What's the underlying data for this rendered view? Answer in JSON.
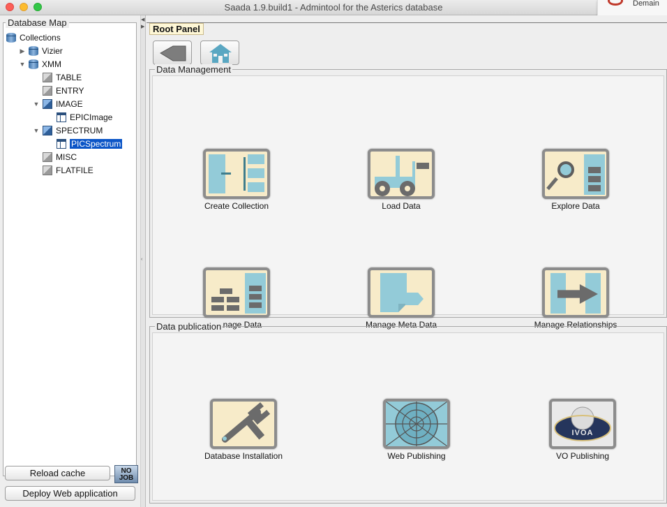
{
  "window": {
    "title": "Saada 1.9.build1 - Admintool for the Asterics database"
  },
  "notification": {
    "text": "Demain"
  },
  "tree": {
    "title": "Database Map",
    "nodes": [
      {
        "label": "Collections",
        "indent": 0,
        "toggle": "",
        "icon": "database-icon"
      },
      {
        "label": "Vizier",
        "indent": 1,
        "toggle": "▶",
        "icon": "database-icon"
      },
      {
        "label": "XMM",
        "indent": 1,
        "toggle": "▼",
        "icon": "database-icon"
      },
      {
        "label": "TABLE",
        "indent": 2,
        "toggle": "",
        "icon": "cube-icon"
      },
      {
        "label": "ENTRY",
        "indent": 2,
        "toggle": "",
        "icon": "cube-icon"
      },
      {
        "label": "IMAGE",
        "indent": 2,
        "toggle": "▼",
        "icon": "cube-blue-icon"
      },
      {
        "label": "EPICImage",
        "indent": 3,
        "toggle": "",
        "icon": "table-icon"
      },
      {
        "label": "SPECTRUM",
        "indent": 2,
        "toggle": "▼",
        "icon": "cube-blue-icon"
      },
      {
        "label": "PICSpectrum",
        "indent": 3,
        "toggle": "",
        "icon": "table-icon",
        "selected": true
      },
      {
        "label": "MISC",
        "indent": 2,
        "toggle": "",
        "icon": "cube-icon"
      },
      {
        "label": "FLATFILE",
        "indent": 2,
        "toggle": "",
        "icon": "cube-icon"
      }
    ]
  },
  "left_buttons": {
    "reload": "Reload cache",
    "deploy": "Deploy Web application",
    "nojob_line1": "NO",
    "nojob_line2": "JOB"
  },
  "root_panel": {
    "title": "Root Panel"
  },
  "data_management": {
    "title": "Data Management",
    "tiles": [
      {
        "label": "Create Collection",
        "icon": "create-collection-icon"
      },
      {
        "label": "Load Data",
        "icon": "forklift-icon"
      },
      {
        "label": "Explore Data",
        "icon": "magnifier-icon"
      },
      {
        "label": "Manage Data",
        "icon": "bricks-icon"
      },
      {
        "label": "Manage Meta Data",
        "icon": "document-tag-icon"
      },
      {
        "label": "Manage Relationships",
        "icon": "arrow-relation-icon"
      }
    ]
  },
  "data_publication": {
    "title": "Data publication",
    "tiles": [
      {
        "label": "Database Installation",
        "icon": "wrench-icon"
      },
      {
        "label": "Web Publishing",
        "icon": "web-icon"
      },
      {
        "label": "VO Publishing",
        "icon": "ivoa-logo-icon",
        "logo_text": "IVOA"
      }
    ]
  },
  "colors": {
    "selection": "#0b55c7",
    "tile_bg": "#f7ebc9",
    "tile_accent": "#93cbd8"
  }
}
